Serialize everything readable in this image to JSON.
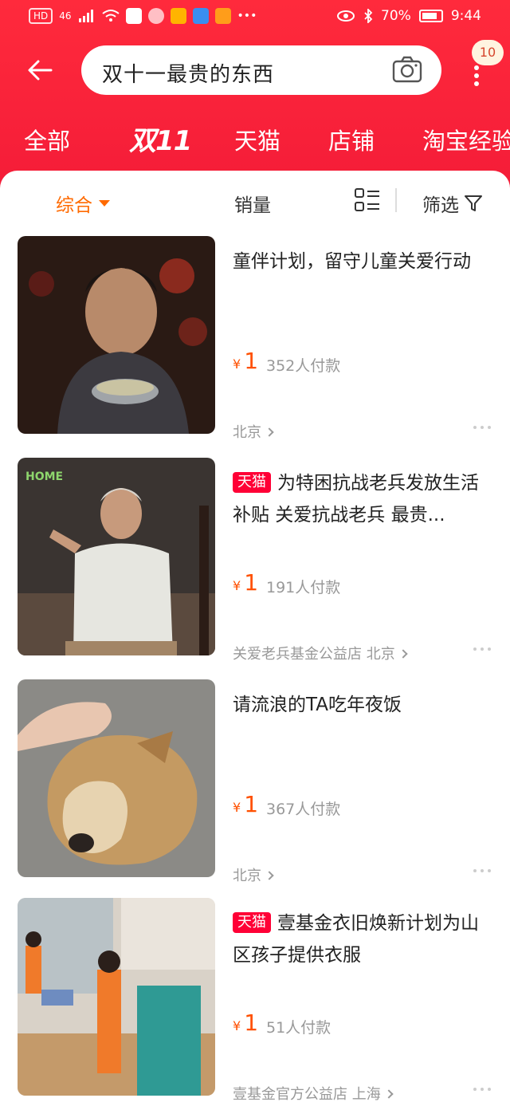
{
  "statusbar": {
    "network": "HD",
    "signal": "46",
    "battery": "70%",
    "time": "9:44"
  },
  "search": {
    "query": "双十一最贵的东西",
    "badge_count": "10"
  },
  "tabs": [
    "全部",
    "双11",
    "天猫",
    "店铺",
    "淘宝经验"
  ],
  "sortbar": {
    "overall": "综合",
    "sales": "销量",
    "filter": "筛选"
  },
  "products": [
    {
      "title": "童伴计划，留守儿童关爱行动",
      "tmall": "",
      "price_symbol": "¥",
      "price": "1",
      "paid": "352人付款",
      "location": "北京"
    },
    {
      "title": "为特困抗战老兵发放生活补贴 关爱抗战老兵 最贵...",
      "tmall": "天猫",
      "price_symbol": "¥",
      "price": "1",
      "paid": "191人付款",
      "location": "关爱老兵基金公益店 北京"
    },
    {
      "title": "请流浪的TA吃年夜饭",
      "tmall": "",
      "price_symbol": "¥",
      "price": "1",
      "paid": "367人付款",
      "location": "北京"
    },
    {
      "title": "壹基金衣旧焕新计划为山区孩子提供衣服",
      "tmall": "天猫",
      "price_symbol": "¥",
      "price": "1",
      "paid": "51人付款",
      "location": "壹基金官方公益店 上海"
    }
  ],
  "colors": {
    "brand_red": "#f41c38",
    "price_orange": "#ff5000",
    "tmall_red": "#ff0036",
    "sort_active": "#ff6a00"
  },
  "thumb_texts": {
    "home_logo": "HOME"
  }
}
